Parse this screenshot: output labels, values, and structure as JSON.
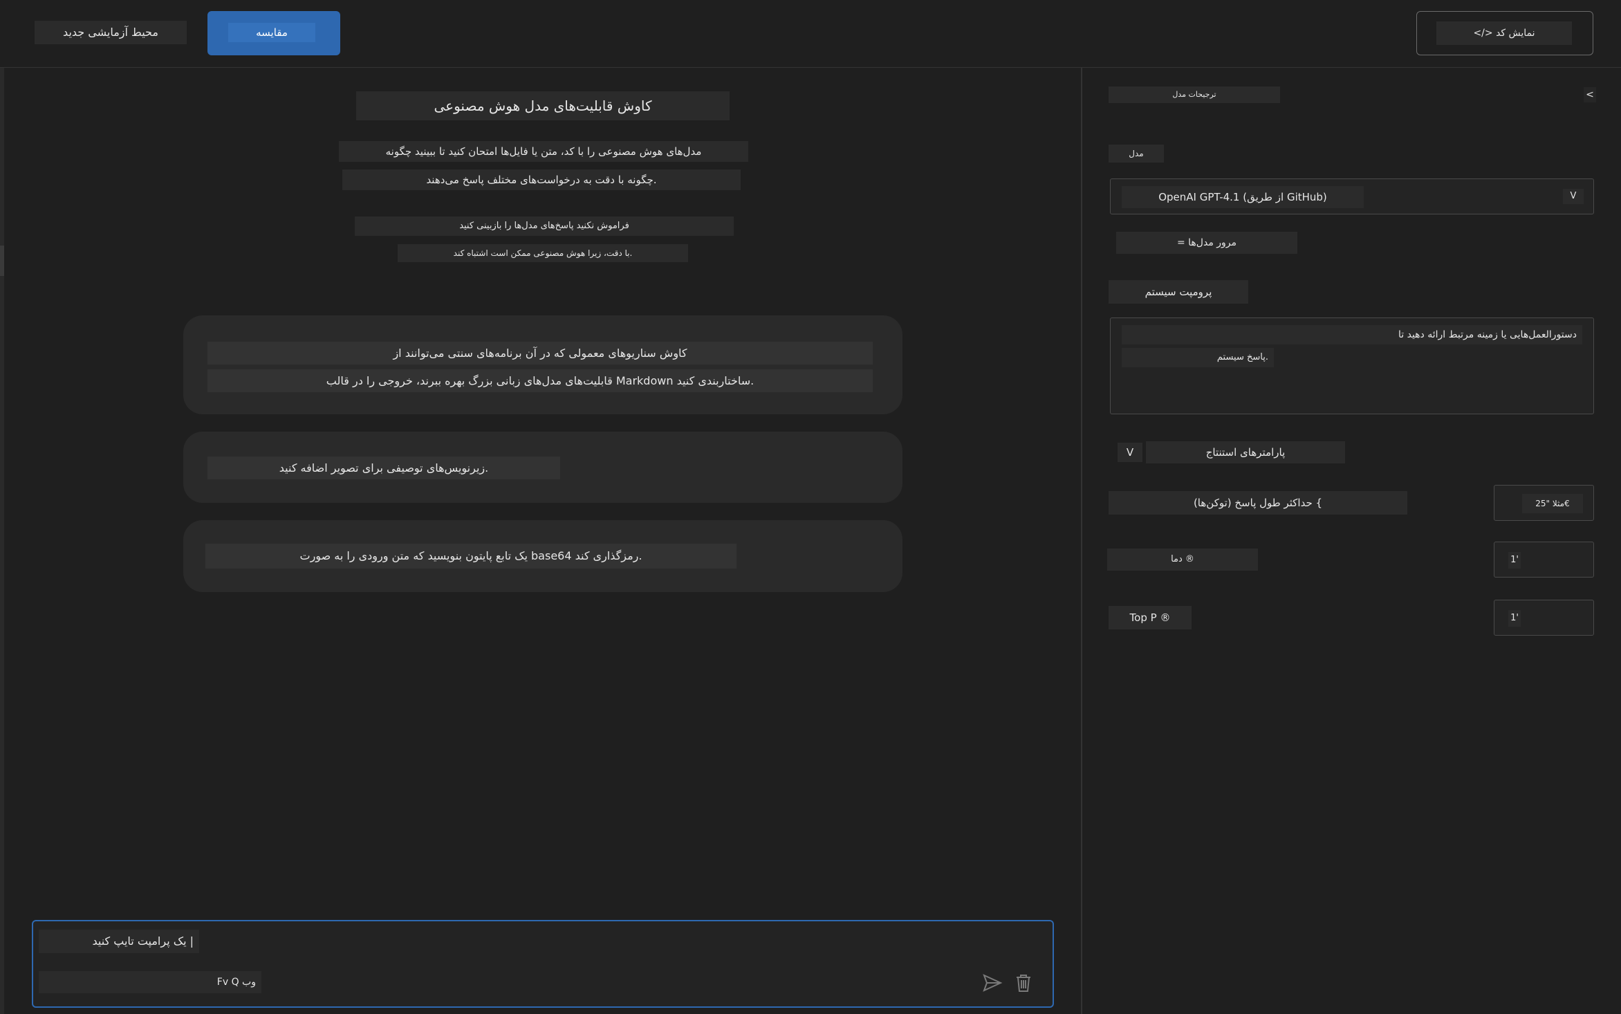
{
  "header": {
    "new_playground_label": "محیط آزمایشی جدید",
    "compare_label": "مقایسه",
    "view_code_label": "</> نمایش کد"
  },
  "main": {
    "title": "کاوش قابلیت‌های مدل هوش مصنوعی",
    "subtitle_line1": "مدل‌های هوش مصنوعی را با کد، متن یا فایل‌ها امتحان کنید تا ببینید چگونه",
    "subtitle_line2": "چگونه با دقت به درخواست‌های مختلف پاسخ می‌دهند.",
    "note_line1": "فراموش نکنید پاسخ‌های مدل‌ها را بازبینی کنید",
    "note_line2": "با دقت، زیرا هوش مصنوعی ممکن است اشتباه کند.",
    "suggestions": [
      {
        "line1": "کاوش سناریوهای معمولی که در آن برنامه‌های سنتی می‌توانند از",
        "line2": "قابلیت‌های مدل‌های زبانی بزرگ بهره ببرند، خروجی را در قالب Markdown ساختاربندی کنید."
      },
      {
        "line1": "زیرنویس‌های توصیفی برای تصویر اضافه کنید."
      },
      {
        "line1": "یک تابع پایتون بنویسید که متن ورودی را به صورت base64 رمزگذاری کند."
      }
    ]
  },
  "prompt": {
    "placeholder": "یک پرامپت تایپ کنید |",
    "footer_text": "Fv Q وب"
  },
  "sidebar": {
    "collapse_glyph": "<",
    "preferences_label": "ترجیحات مدل",
    "model_label": "مدل",
    "model_value": "OpenAI GPT-4.1 (از طریق GitHub)",
    "dropdown_glyph": "V",
    "browse_models_label": "= مرور مدل‌ها",
    "system_prompt_label": "پرومپت سیستم",
    "system_prompt_line1": "دستورالعمل‌هایی یا زمینه مرتبط ارائه دهید تا",
    "system_prompt_line2": "پاسخ سیستم.",
    "inference_label": "پارامترهای استنتاج",
    "inference_toggle_glyph": "V",
    "max_tokens_label": "حداکثر طول پاسخ (توکن‌ها) {",
    "max_tokens_placeholder": "مثلا \"25€",
    "temperature_label": "دما ®",
    "temperature_value": "1'",
    "top_p_label": "Top P ®",
    "top_p_value": "1'"
  }
}
